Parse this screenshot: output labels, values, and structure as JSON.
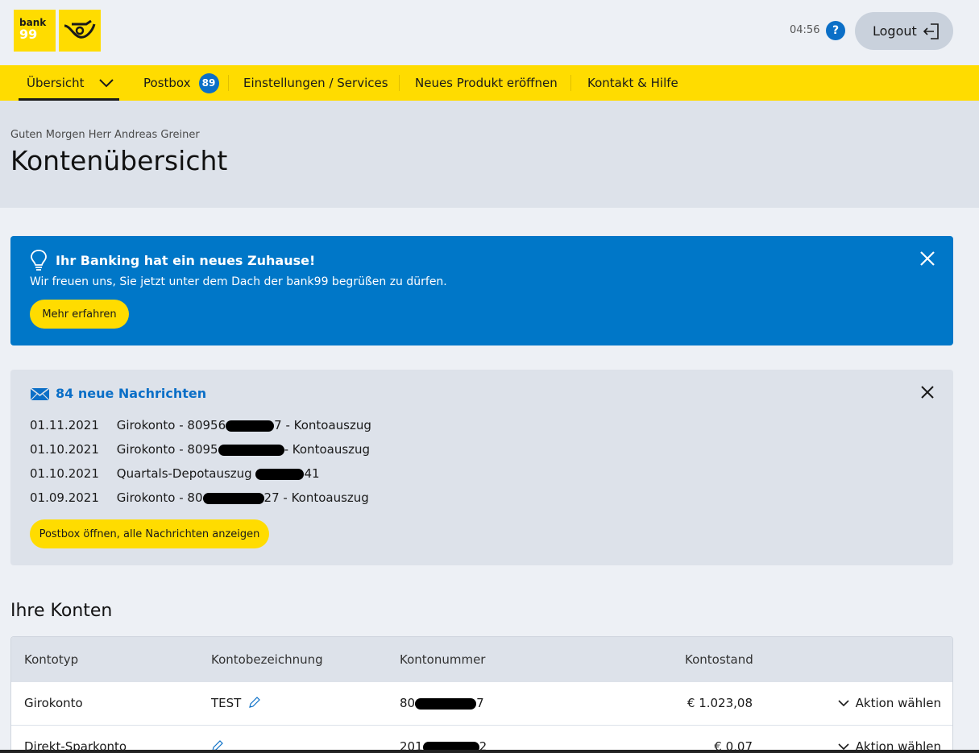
{
  "header": {
    "logo_bank_line1": "bank",
    "logo_bank_line2": "99",
    "session_timer": "04:56",
    "help_label": "?",
    "logout_label": "Logout"
  },
  "nav": {
    "items": [
      {
        "label": "Übersicht"
      },
      {
        "label": "Postbox",
        "badge": "89"
      },
      {
        "label": "Einstellungen / Services"
      },
      {
        "label": "Neues Produkt eröffnen"
      },
      {
        "label": "Kontakt & Hilfe"
      }
    ]
  },
  "greeting": "Guten Morgen Herr Andreas Greiner",
  "page_title": "Kontenübersicht",
  "banner": {
    "title": "Ihr Banking hat ein neues Zuhause!",
    "text": "Wir freuen uns, Sie jetzt unter dem Dach der bank99 begrüßen zu dürfen.",
    "button": "Mehr erfahren"
  },
  "messages": {
    "title": "84 neue Nachrichten",
    "rows": [
      {
        "date": "01.11.2021",
        "prefix": "Girokonto - 80956",
        "suffix": "7 - Kontoauszug"
      },
      {
        "date": "01.10.2021",
        "prefix": "Girokonto - 8095",
        "suffix": "- Kontoauszug"
      },
      {
        "date": "01.10.2021",
        "prefix": "Quartals-Depotauszug ",
        "suffix": "41"
      },
      {
        "date": "01.09.2021",
        "prefix": "Girokonto - 80",
        "suffix": "27 - Kontoauszug"
      }
    ],
    "button": "Postbox öffnen, alle Nachrichten anzeigen"
  },
  "accounts": {
    "title": "Ihre Konten",
    "columns": [
      "Kontotyp",
      "Kontobezeichnung",
      "Kontonummer",
      "Kontostand"
    ],
    "rows": [
      {
        "type": "Girokonto",
        "name": "TEST",
        "number_prefix": "80",
        "number_suffix": "7",
        "balance": "€ 1.023,08",
        "action": "Aktion wählen"
      },
      {
        "type": "Direkt-Sparkonto",
        "name": "",
        "number_prefix": "201",
        "number_suffix": "2",
        "balance": "€ 0,07",
        "action": "Aktion wählen"
      }
    ]
  },
  "colors": {
    "brand_yellow": "#ffdc00",
    "brand_blue": "#0077c8",
    "link_blue": "#0b6fc7"
  }
}
